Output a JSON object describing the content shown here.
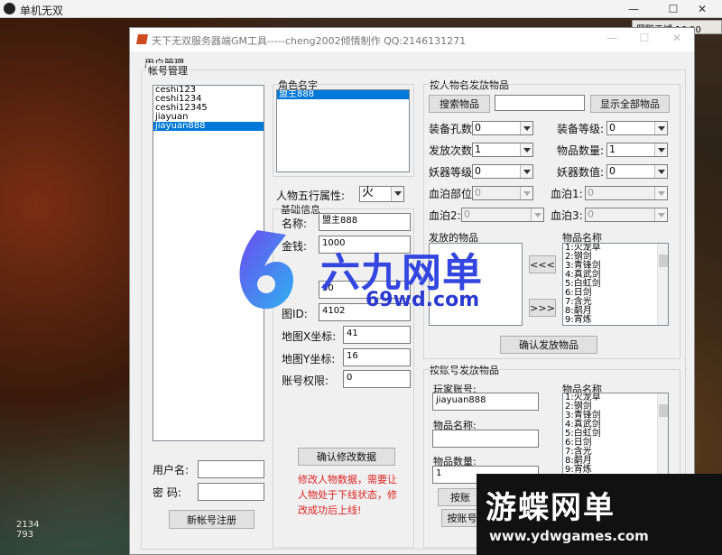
{
  "outer_window": {
    "title": "单机无双"
  },
  "game_hud": {
    "line": "罢黥于城 16 90"
  },
  "hud_stats": {
    "line1": "2134",
    "line2": "793"
  },
  "app": {
    "title": "天下无双服务器端GM工具-----cheng2002倾情制作  QQ:2146131271"
  },
  "user_mgmt": {
    "legend": "用户管理"
  },
  "account_mgmt": {
    "legend": "帐号管理",
    "accounts": [
      "ceshi123",
      "ceshi1234",
      "ceshi12345",
      "jiayuan",
      "jiayuan888"
    ],
    "selected_account": "jiayuan888",
    "username_label": "用户名:",
    "password_label": "密   码:",
    "register_button": "新帐号注册"
  },
  "role": {
    "legend": "角色名字",
    "roles": [
      "盟主888"
    ],
    "element_label": "人物五行属性:",
    "element_value": "火",
    "basic_legend": "基础信息",
    "name_label": "名称:",
    "name_value": "盟主888",
    "money_label": "金钱:",
    "money_value": "1000",
    "field3_value": "50",
    "map_id_label": "图ID:",
    "map_id_value": "4102",
    "map_x_label": "地图X坐标:",
    "map_x_value": "41",
    "map_y_label": "地图Y坐标:",
    "map_y_value": "16",
    "perm_label": "账号权限:",
    "perm_value": "0",
    "confirm_button": "确认修改数据",
    "note": "修改人物数据，需要让人物处于下线状态，修改成功后上线!"
  },
  "by_name": {
    "legend": "按人物名发放物品",
    "search_button": "搜索物品",
    "show_all_button": "显示全部物品",
    "search_value": "",
    "equip_holes_label": "装备孔数:",
    "equip_holes": "0",
    "equip_level_label": "装备等级:",
    "equip_level": "0",
    "send_times_label": "发放次数:",
    "send_times": "1",
    "item_qty_label": "物品数量:",
    "item_qty": "1",
    "demon_level_label": "妖器等级:",
    "demon_level": "0",
    "demon_value_label": "妖器数值:",
    "demon_value": "0",
    "blood_part_label": "血泊部位:",
    "blood_part": "0",
    "blood1_label": "血泊1:",
    "blood1": "0",
    "blood2_label": "血泊2:",
    "blood2": "0",
    "blood3_label": "血泊3:",
    "blood3": "0",
    "sent_items_label": "发放的物品",
    "item_names_label": "物品名称",
    "item_names": [
      "1:火龙草",
      "2:钢剑",
      "3:青锋剑",
      "4:真武剑",
      "5:白虹剑",
      "6:日剑",
      "7:含光",
      "8:鹬月",
      "9:宵炼"
    ],
    "move_left_button": "<<<",
    "move_right_button": ">>>",
    "confirm_send_button": "确认发放物品"
  },
  "by_account": {
    "legend": "按账号发放物品",
    "player_account_label": "玩家账号:",
    "player_account": "jiayuan888",
    "item_name_label": "物品名称:",
    "item_name_value": "",
    "item_qty_label": "物品数量:",
    "item_qty": "1",
    "item_names_label": "物品名称",
    "item_names": [
      "1:火龙草",
      "2:钢剑",
      "3:青锋剑",
      "4:真武剑",
      "5:白虹剑",
      "6:日剑",
      "7:含光",
      "8:鹬月",
      "9:宵炼"
    ],
    "send_button_1": "按账",
    "send_button_2": "按账号"
  },
  "watermark1": {
    "text": "六九网单",
    "url": "69wd.com"
  },
  "watermark2": {
    "text": "游蝶网单",
    "url": "www.ydwgames.com"
  },
  "colors": {
    "selection": "#0078d7",
    "note_red": "#dd2222",
    "watermark_blue": "#3346e0"
  }
}
